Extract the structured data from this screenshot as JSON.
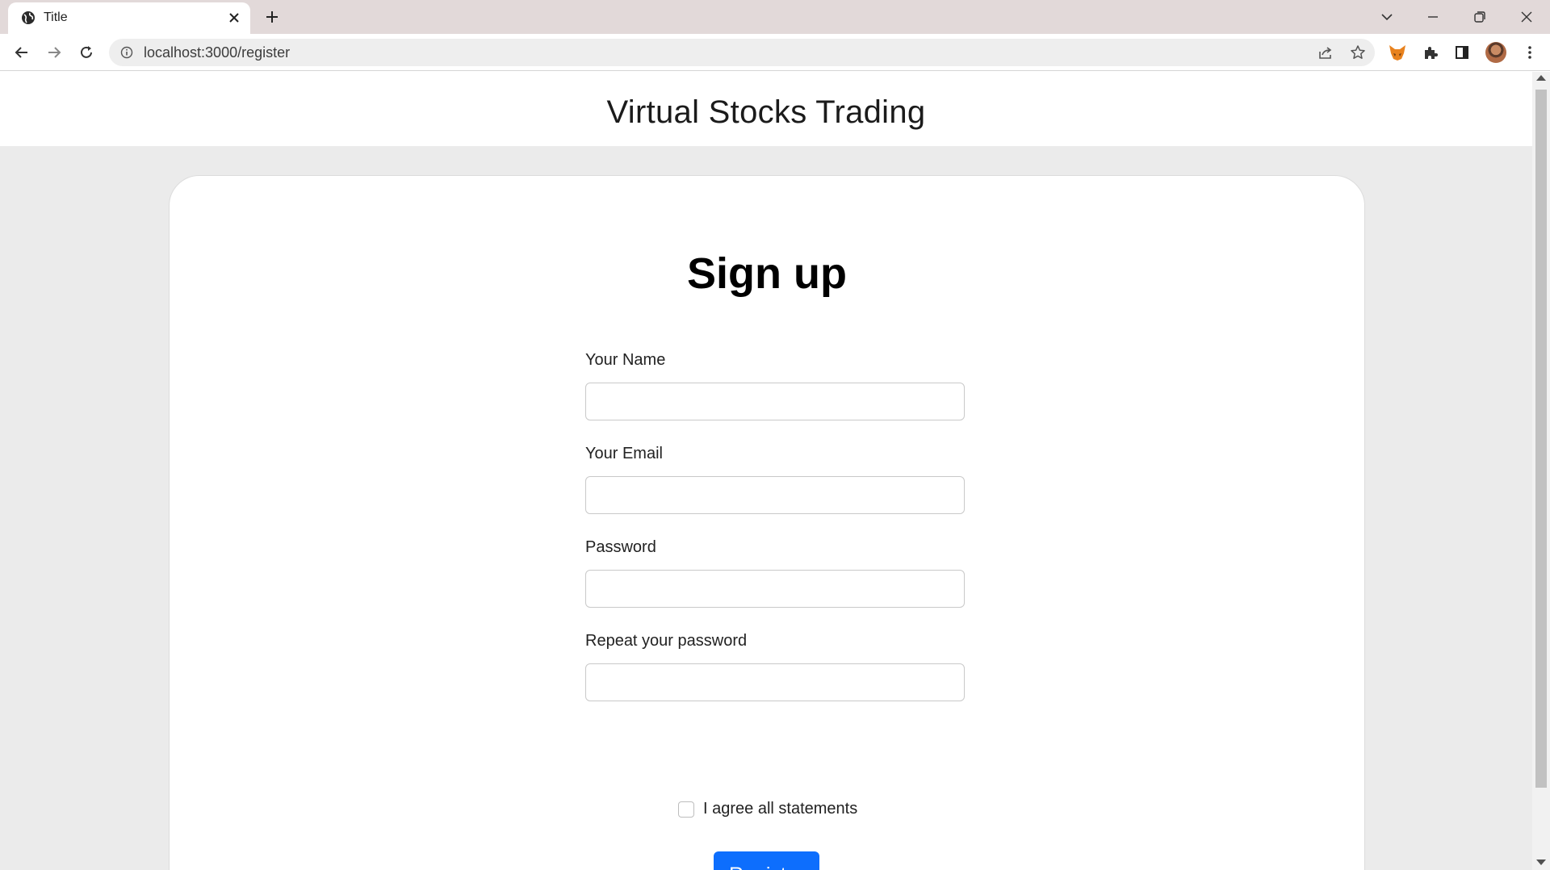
{
  "browser": {
    "tab_title": "Title",
    "url": "localhost:3000/register"
  },
  "page": {
    "site_title": "Virtual Stocks Trading",
    "card_title": "Sign up",
    "fields": [
      {
        "label": "Your Name",
        "value": "",
        "type": "text"
      },
      {
        "label": "Your Email",
        "value": "",
        "type": "email"
      },
      {
        "label": "Password",
        "value": "",
        "type": "password"
      },
      {
        "label": "Repeat your password",
        "value": "",
        "type": "password"
      }
    ],
    "agree_label": "I agree all statements",
    "agree_checked": false,
    "register_label": "Register",
    "accent_color": "#0d6efd"
  },
  "icons": [
    "globe-icon",
    "close-icon",
    "plus-icon",
    "chevron-down-icon",
    "minimize-icon",
    "restore-icon",
    "back-arrow-icon",
    "forward-arrow-icon",
    "reload-icon",
    "info-icon",
    "share-icon",
    "star-icon",
    "fox-extension-icon",
    "puzzle-icon",
    "side-panel-icon",
    "kebab-menu-icon"
  ]
}
